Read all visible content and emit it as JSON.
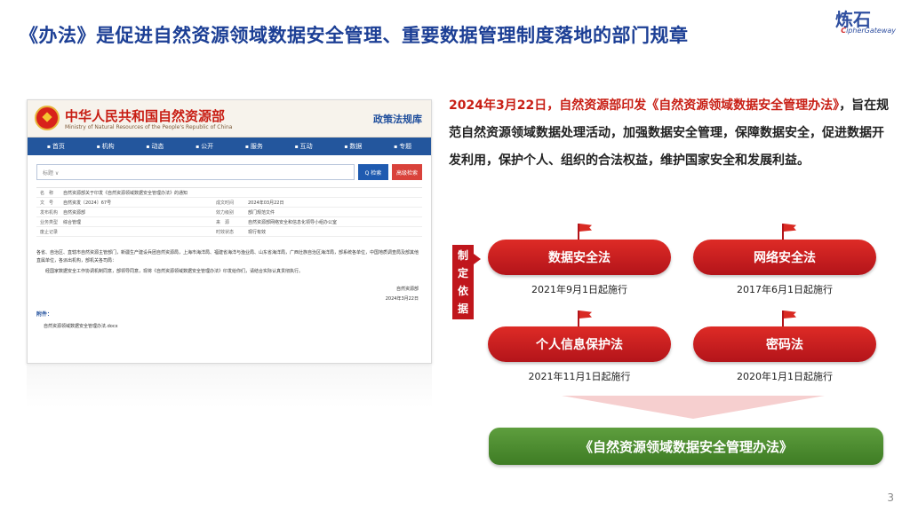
{
  "title": "《办法》是促进自然资源领域数据安全管理、重要数据管理制度落地的部门规章",
  "logo": {
    "cn": "炼石",
    "en_prefix": "C",
    "en_rest": "ipherGateway"
  },
  "website": {
    "org_cn": "中华人民共和国自然资源部",
    "org_en": "Ministry of Natural Resources of the People's Republic of China",
    "library": "政策法规库",
    "nav": [
      "首页",
      "机构",
      "动态",
      "公开",
      "服务",
      "互动",
      "数据",
      "专题"
    ],
    "search_placeholder": "标题 ∨",
    "search_button": "Q 检索",
    "advanced_button": "高级检索",
    "meta": [
      {
        "k": "名　称",
        "v": "自然资源部关于印发《自然资源领域数据安全管理办法》的通知",
        "k2": "",
        "v2": ""
      },
      {
        "k": "文　号",
        "v": "自然资发〔2024〕67号",
        "k2": "成文时间",
        "v2": "2024年03月22日"
      },
      {
        "k": "发布机构",
        "v": "自然资源部",
        "k2": "效力级别",
        "v2": "部门规范文件"
      },
      {
        "k": "业务类型",
        "v": "综合管理",
        "k2": "来　源",
        "v2": "自然资源部网络安全和信息化领导小组办公室"
      },
      {
        "k": "废止记录",
        "v": "",
        "k2": "时效状态",
        "v2": "现行有效"
      }
    ],
    "body": "各省、自治区、直辖市自然资源主管部门，新疆生产建设兵团自然资源局，上海市海洋局、福建省海洋与渔业局、山东省海洋局，广西壮族自治区海洋局，部系统各单位，中国地质调查局及部其他直属单位，各派出机构，部机关各司局：",
    "body2": "经国家数据安全工作协调机制同意，部领导同意，现将《自然资源领域数据安全管理办法》印发给你们，请结合实际认真贯彻执行。",
    "sign": "自然资源部",
    "sign_date": "2024年3月22日",
    "attachment_label": "附件：",
    "attachment": "自然资源领域数据安全管理办法.docx"
  },
  "description": {
    "part1": "2024年3月22日，自然资源部印发《自然资源领域数据安全管理办法》",
    "part2": "，旨在规范自然资源领域数据处理活动，加强数据安全管理，保障数据安全，促进数据开发利用，保护个人、组织的合法权益，维护国家安全和发展利益。"
  },
  "basis_label": "制定依据",
  "laws": [
    {
      "name": "数据安全法",
      "date": "2021年9月1日起施行"
    },
    {
      "name": "网络安全法",
      "date": "2017年6月1日起施行"
    },
    {
      "name": "个人信息保护法",
      "date": "2021年11月1日起施行"
    },
    {
      "name": "密码法",
      "date": "2020年1月1日起施行"
    }
  ],
  "measure": "《自然资源领域数据安全管理办法》",
  "page_number": "3",
  "colors": {
    "title": "#1c3f95",
    "red": "#c81e14",
    "green": "#3e7c24"
  }
}
